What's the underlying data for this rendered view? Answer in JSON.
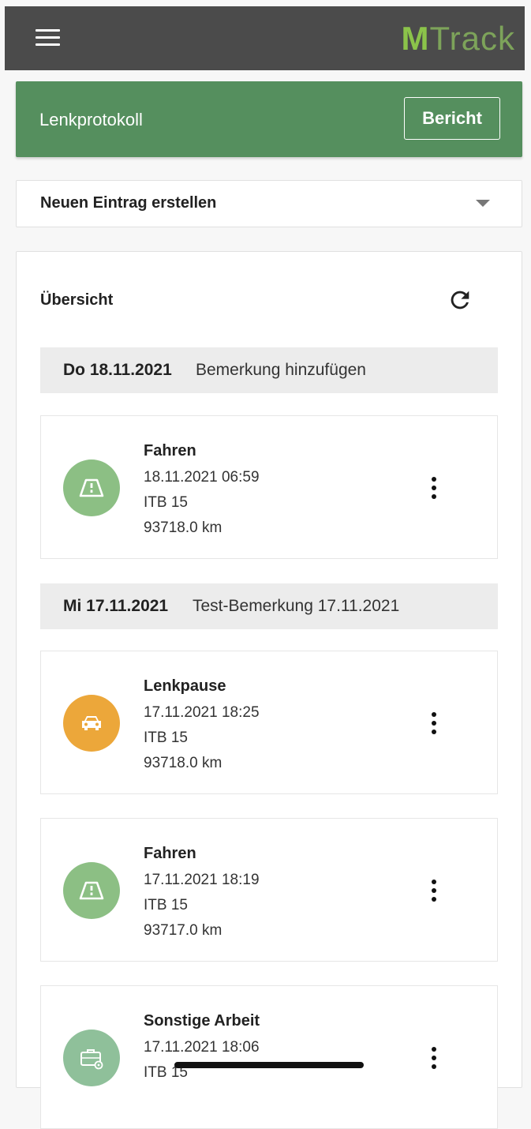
{
  "app": {
    "logo_m": "M",
    "logo_rest": "Track"
  },
  "header": {
    "title": "Lenkprotokoll",
    "report_button": "Bericht"
  },
  "new_entry": {
    "label": "Neuen Eintrag erstellen"
  },
  "overview": {
    "title": "Übersicht",
    "days": [
      {
        "date": "Do 18.11.2021",
        "note": "Bemerkung hinzufügen",
        "entries": [
          {
            "type": "Fahren",
            "datetime": "18.11.2021 06:59",
            "vehicle": "ITB 15",
            "km": "93718.0 km",
            "icon": "road-icon",
            "color": "#8cbf84"
          }
        ]
      },
      {
        "date": "Mi 17.11.2021",
        "note": "Test-Bemerkung 17.11.2021",
        "entries": [
          {
            "type": "Lenkpause",
            "datetime": "17.11.2021 18:25",
            "vehicle": "ITB 15",
            "km": "93718.0 km",
            "icon": "car-icon",
            "color": "#eca73a"
          },
          {
            "type": "Fahren",
            "datetime": "17.11.2021 18:19",
            "vehicle": "ITB 15",
            "km": "93717.0 km",
            "icon": "road-icon",
            "color": "#8cbf84"
          },
          {
            "type": "Sonstige Arbeit",
            "datetime": "17.11.2021 18:06",
            "vehicle": "ITB 15",
            "km": "",
            "icon": "briefcase-gear-icon",
            "color": "#8fc09a"
          }
        ]
      }
    ]
  },
  "colors": {
    "app_bar": "#4b4b4b",
    "header_green": "#558f5e",
    "logo_green": "#8bc34a",
    "day_bar": "#ececec"
  }
}
